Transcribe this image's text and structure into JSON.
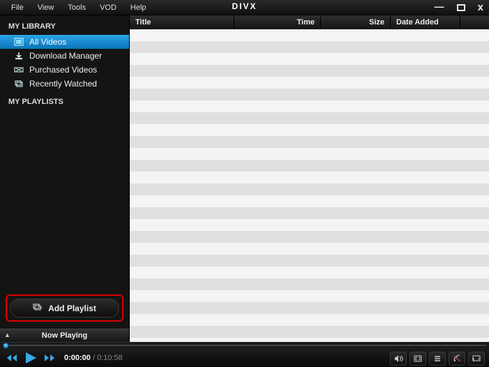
{
  "menu": {
    "items": [
      "File",
      "View",
      "Tools",
      "VOD",
      "Help"
    ]
  },
  "app": {
    "logo": "DIVX"
  },
  "window": {
    "min": "—",
    "close": "x"
  },
  "sidebar": {
    "library_title": "MY LIBRARY",
    "playlists_title": "MY PLAYLISTS",
    "items": [
      {
        "label": "All Videos",
        "icon": "film"
      },
      {
        "label": "Download Manager",
        "icon": "download"
      },
      {
        "label": "Purchased Videos",
        "icon": "ticket"
      },
      {
        "label": "Recently Watched",
        "icon": "stack"
      }
    ],
    "add_playlist_label": "Add Playlist",
    "now_playing_label": "Now Playing"
  },
  "columns": {
    "title": "Title",
    "time": "Time",
    "size": "Size",
    "date": "Date Added"
  },
  "player": {
    "current": "0:00:00",
    "separator": " / ",
    "duration": "0:10:58"
  }
}
